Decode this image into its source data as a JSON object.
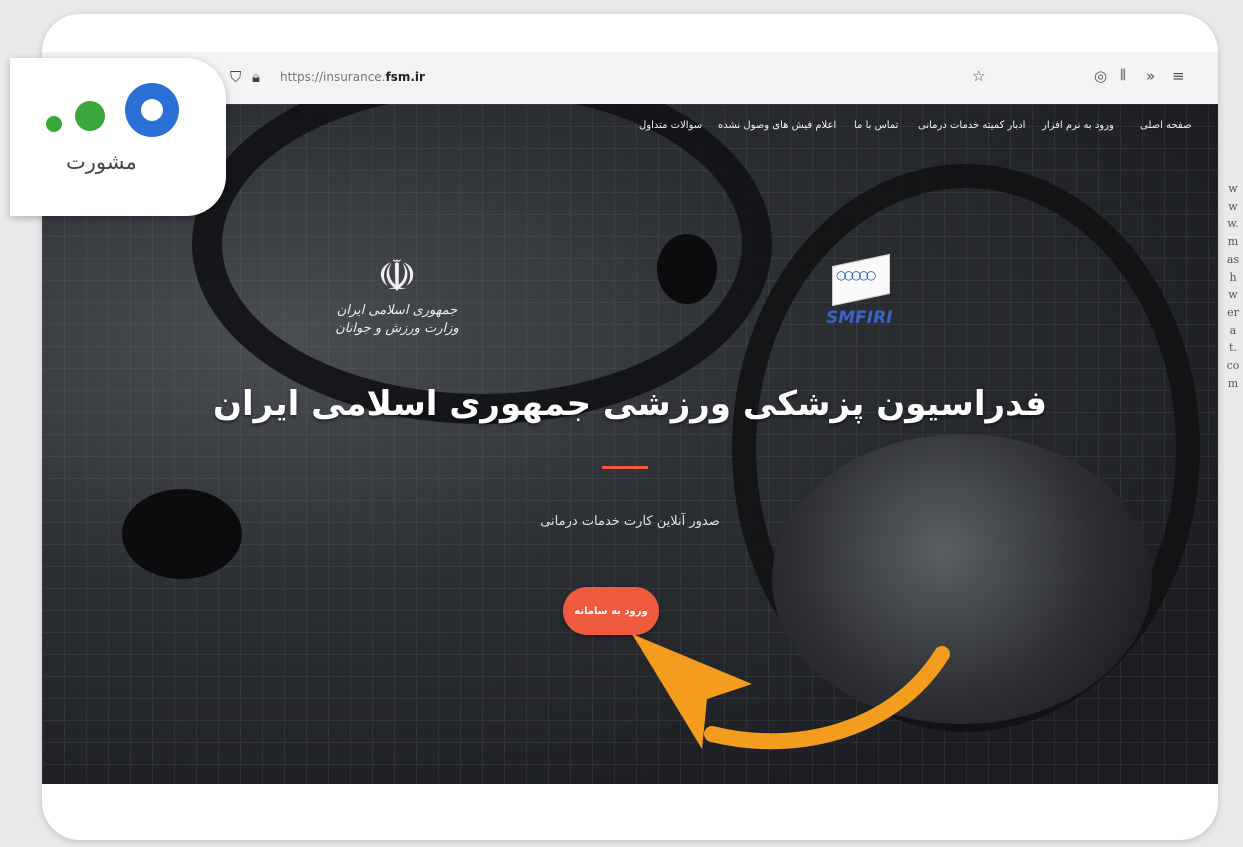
{
  "browser": {
    "url_prefix": "https://insurance.",
    "url_domain": "fsm.ir",
    "icons": [
      "shield-icon",
      "lock-icon",
      "star-icon",
      "pocket-icon",
      "library-icon",
      "overflow-icon",
      "menu-icon"
    ]
  },
  "nav": {
    "items": [
      "صفحه اصلی",
      "ورود به نرم افزار",
      "ادبار کمیته خدمات درمانی",
      "تماس با ما",
      "اعلام فیش های وصول نشده",
      "سوالات متداول"
    ]
  },
  "logos": {
    "left_lines": [
      "جمهوری اسلامی ایران",
      "وزارت ورزش و جوانان"
    ],
    "right_text": "SMFIRI"
  },
  "hero": {
    "title": "فدراسیون پزشکی ورزشی جمهوری اسلامی ایران",
    "subtitle": "صدور آنلاین کارت خدمات درمانی",
    "cta": "ورود به سامانه"
  },
  "overlay": {
    "logo_text": "مشورت",
    "watermark": "www.mashwerat.com"
  },
  "colors": {
    "accent": "#ee5b3e",
    "arrow": "#f39c1e",
    "logo_blue": "#2a6fd6",
    "logo_green": "#3aa63b"
  }
}
